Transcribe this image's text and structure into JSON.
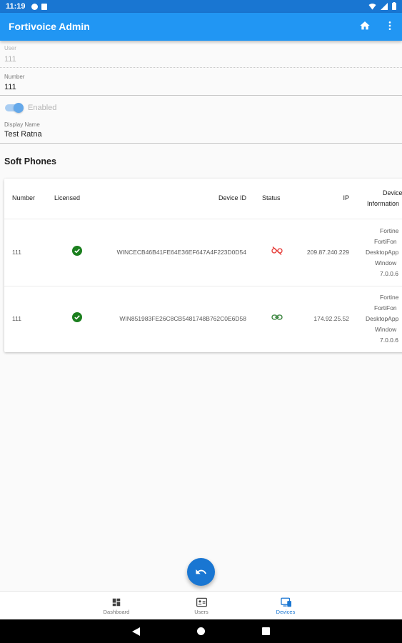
{
  "status_bar": {
    "time": "11:19"
  },
  "app_bar": {
    "title": "Fortivoice Admin",
    "home_icon": "home-icon",
    "menu_icon": "more-vert-icon"
  },
  "form": {
    "user": {
      "label": "User",
      "value": "111"
    },
    "number": {
      "label": "Number",
      "value": "111"
    },
    "enabled": {
      "label": "Enabled",
      "on": true
    },
    "display_name": {
      "label": "Display Name",
      "value": "Test Ratna"
    }
  },
  "soft_phones": {
    "title": "Soft Phones",
    "columns": [
      "Number",
      "Licensed",
      "Device ID",
      "Status",
      "IP",
      "Device",
      "Information"
    ],
    "rows": [
      {
        "number": "111",
        "licensed": true,
        "device_id": "WINCECB46B41FE64E36EF647A4F223D0D54",
        "status": "disconnected",
        "ip": "209.87.240.229",
        "info": [
          "Fortine",
          "FortiFon",
          "DesktopApp",
          "Window",
          "7.0.0.6"
        ]
      },
      {
        "number": "111",
        "licensed": true,
        "device_id": "WIN851983FE26C8CB5481748B762C0E6D58",
        "status": "connected",
        "ip": "174.92.25.52",
        "info": [
          "Fortine",
          "FortiFon",
          "DesktopApp",
          "Window",
          "7.0.0.6"
        ]
      }
    ]
  },
  "fab": {
    "icon": "undo-icon"
  },
  "bottom_nav": [
    {
      "label": "Dashboard",
      "icon": "dashboard-icon",
      "active": false
    },
    {
      "label": "Users",
      "icon": "users-icon",
      "active": false
    },
    {
      "label": "Devices",
      "icon": "devices-icon",
      "active": true
    }
  ],
  "colors": {
    "primary": "#2196f3",
    "primary_dark": "#1976d2",
    "success": "#1b7f1e",
    "error": "#e53935",
    "connected": "#2e7d32"
  }
}
